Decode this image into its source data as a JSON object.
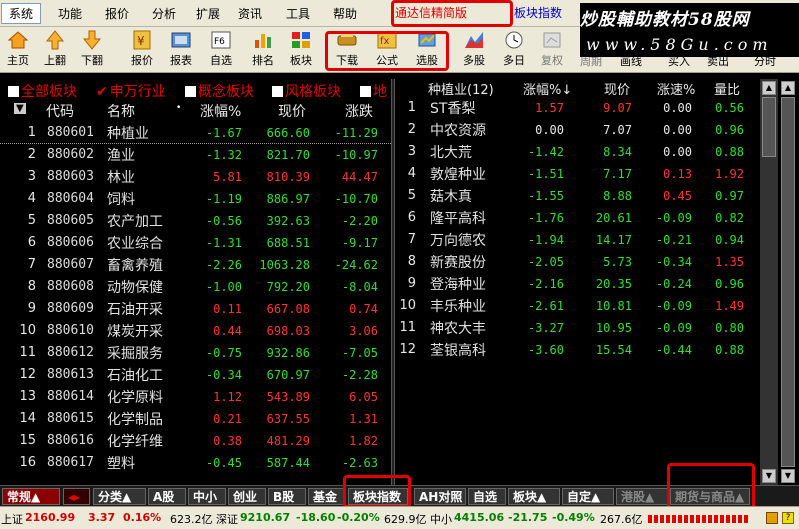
{
  "menu": [
    "系统",
    "功能",
    "报价",
    "分析",
    "扩展",
    "资讯",
    "工具",
    "帮助"
  ],
  "brand": "通达信精简版",
  "board_title": "板块指数",
  "watermark": {
    "line1": "炒股輔助教材58股网",
    "line2": "www.58Gu.com"
  },
  "toolbar": [
    {
      "label": "主页",
      "icon": "home-icon"
    },
    {
      "label": "上翻",
      "icon": "arrow-up-icon"
    },
    {
      "label": "下翻",
      "icon": "arrow-down-icon"
    },
    {
      "label": "报价",
      "icon": "quote-icon"
    },
    {
      "label": "报表",
      "icon": "report-icon"
    },
    {
      "label": "自选",
      "icon": "f6-icon"
    },
    {
      "label": "排名",
      "icon": "ranking-icon"
    },
    {
      "label": "板块",
      "icon": "blocks-icon"
    },
    {
      "label": "下载",
      "icon": "download-icon"
    },
    {
      "label": "公式",
      "icon": "formula-icon"
    },
    {
      "label": "选股",
      "icon": "stock-pick-icon"
    },
    {
      "label": "多股",
      "icon": "multi-stock-icon"
    },
    {
      "label": "多日",
      "icon": "clock-icon"
    },
    {
      "label": "复权",
      "icon": "restore-icon"
    },
    {
      "label": "周期",
      "icon": "period-icon"
    },
    {
      "label": "画线",
      "icon": "draw-line-icon"
    },
    {
      "label": "买入",
      "icon": "buy-icon"
    },
    {
      "label": "卖出",
      "icon": "sell-icon"
    },
    {
      "label": "分时",
      "icon": "intraday-icon"
    }
  ],
  "tabs": [
    "全部板块",
    "申万行业",
    "概念板块",
    "风格板块",
    "地"
  ],
  "left_headers": [
    "代码",
    "名称",
    "涨幅%",
    "现价",
    "涨跌"
  ],
  "left_rows": [
    {
      "n": "1",
      "code": "880601",
      "name": "种植业",
      "chg": "-1.67",
      "price": "666.60",
      "diff": "-11.29"
    },
    {
      "n": "2",
      "code": "880602",
      "name": "渔业",
      "chg": "-1.32",
      "price": "821.70",
      "diff": "-10.97"
    },
    {
      "n": "3",
      "code": "880603",
      "name": "林业",
      "chg": "5.81",
      "price": "810.39",
      "diff": "44.47"
    },
    {
      "n": "4",
      "code": "880604",
      "name": "饲料",
      "chg": "-1.19",
      "price": "886.97",
      "diff": "-10.70"
    },
    {
      "n": "5",
      "code": "880605",
      "name": "农产加工",
      "chg": "-0.56",
      "price": "392.63",
      "diff": "-2.20"
    },
    {
      "n": "6",
      "code": "880606",
      "name": "农业综合",
      "chg": "-1.31",
      "price": "688.51",
      "diff": "-9.17"
    },
    {
      "n": "7",
      "code": "880607",
      "name": "畜禽养殖",
      "chg": "-2.26",
      "price": "1063.28",
      "diff": "-24.62"
    },
    {
      "n": "8",
      "code": "880608",
      "name": "动物保健",
      "chg": "-1.00",
      "price": "792.20",
      "diff": "-8.04"
    },
    {
      "n": "9",
      "code": "880609",
      "name": "石油开采",
      "chg": "0.11",
      "price": "667.08",
      "diff": "0.74"
    },
    {
      "n": "10",
      "code": "880610",
      "name": "煤炭开采",
      "chg": "0.44",
      "price": "698.03",
      "diff": "3.06"
    },
    {
      "n": "11",
      "code": "880612",
      "name": "采掘服务",
      "chg": "-0.75",
      "price": "932.86",
      "diff": "-7.05"
    },
    {
      "n": "12",
      "code": "880613",
      "name": "石油化工",
      "chg": "-0.34",
      "price": "670.97",
      "diff": "-2.28"
    },
    {
      "n": "13",
      "code": "880614",
      "name": "化学原料",
      "chg": "1.12",
      "price": "543.89",
      "diff": "6.05"
    },
    {
      "n": "14",
      "code": "880615",
      "name": "化学制品",
      "chg": "0.21",
      "price": "637.55",
      "diff": "1.31"
    },
    {
      "n": "15",
      "code": "880616",
      "name": "化学纤维",
      "chg": "0.38",
      "price": "481.29",
      "diff": "1.82"
    },
    {
      "n": "16",
      "code": "880617",
      "name": "塑料",
      "chg": "-0.45",
      "price": "587.44",
      "diff": "-2.63"
    }
  ],
  "right_headers": [
    "种植业(12)",
    "涨幅%↓",
    "现价",
    "涨速%",
    "量比"
  ],
  "right_rows": [
    {
      "n": "1",
      "name": "ST香梨",
      "chg": "1.57",
      "price": "9.07",
      "speed": "0.00",
      "ratio": "0.56"
    },
    {
      "n": "2",
      "name": "中农资源",
      "chg": "0.00",
      "price": "7.07",
      "speed": "0.00",
      "ratio": "0.96"
    },
    {
      "n": "3",
      "name": "北大荒",
      "chg": "-1.42",
      "price": "8.34",
      "speed": "0.00",
      "ratio": "0.88"
    },
    {
      "n": "4",
      "name": "敦煌种业",
      "chg": "-1.51",
      "price": "7.17",
      "speed": "0.13",
      "ratio": "1.92"
    },
    {
      "n": "5",
      "name": "菇木真",
      "chg": "-1.55",
      "price": "8.88",
      "speed": "0.45",
      "ratio": "0.97"
    },
    {
      "n": "6",
      "name": "隆平高科",
      "chg": "-1.76",
      "price": "20.61",
      "speed": "-0.09",
      "ratio": "0.82"
    },
    {
      "n": "7",
      "name": "万向德农",
      "chg": "-1.94",
      "price": "14.17",
      "speed": "-0.21",
      "ratio": "0.94"
    },
    {
      "n": "8",
      "name": "新赛股份",
      "chg": "-2.05",
      "price": "5.73",
      "speed": "-0.34",
      "ratio": "1.35"
    },
    {
      "n": "9",
      "name": "登海种业",
      "chg": "-2.16",
      "price": "20.35",
      "speed": "-0.24",
      "ratio": "0.96"
    },
    {
      "n": "10",
      "name": "丰乐种业",
      "chg": "-2.61",
      "price": "10.81",
      "speed": "-0.09",
      "ratio": "1.49"
    },
    {
      "n": "11",
      "name": "神农大丰",
      "chg": "-3.27",
      "price": "10.95",
      "speed": "-0.09",
      "ratio": "0.80"
    },
    {
      "n": "12",
      "name": "荃银高科",
      "chg": "-3.60",
      "price": "15.54",
      "speed": "-0.44",
      "ratio": "0.88"
    }
  ],
  "bottom_tabs": [
    "常规▲",
    "分类▲",
    "A股",
    "中小",
    "创业",
    "B股",
    "基金",
    "板块指数",
    "AH对照",
    "自选",
    "板块▲",
    "自定▲",
    "港股▲",
    "期货与商品▲"
  ],
  "status": {
    "sh_label": "上证",
    "sh_val": "2160.99",
    "sh_diff": "3.37",
    "sh_pct": "0.16%",
    "sh_vol": "623.2亿",
    "sz_label": "深证",
    "sz_val": "9210.67",
    "sz_diff": "-18.60",
    "sz_pct": "-0.20%",
    "sz_vol": "629.9亿",
    "zx_label": "中小",
    "zx_val": "4415.06",
    "zx_diff": "-21.75",
    "zx_pct": "-0.49%",
    "zx_vol": "267.6亿"
  }
}
